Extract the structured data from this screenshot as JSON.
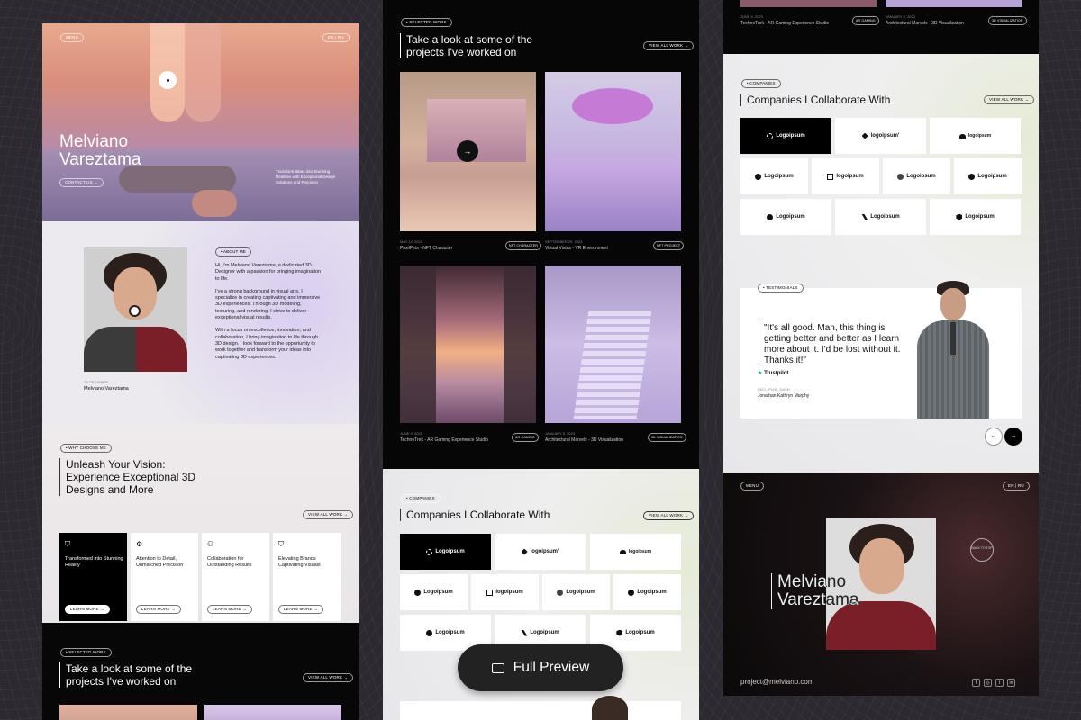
{
  "col1": {
    "menu": "MENU",
    "lang": "EN | RU",
    "hero_name": "Melviano Vareztama",
    "hero_tag": "Transform Ideas into Stunning Realities with Exceptional Design Solutions and Precision",
    "contact": "CONTACT US →",
    "about_tag": "• ABOUT ME",
    "about_p1": "Hi, I'm Melviano Vareztama, a dedicated 3D Designer with a passion for bringing imagination to life.",
    "about_p2": "I've a strong background in visual arts, I specialize in creating captivating and immersive 3D experiences. Through 3D modeling, texturing, and rendering, I strive to deliver exceptional visual results.",
    "about_p3": "With a focus on excellence, innovation, and collaboration, I bring imagination to life through 3D design. I look forward to the opportunity to work together and transform your ideas into captivating 3D experiences.",
    "role": "3D DESIGNER",
    "person": "Melviano Vareztama",
    "why_tag": "• WHY CHOOSE ME",
    "why_head": "Unleash Your Vision: Experience Exceptional 3D Designs and More",
    "view_all": "VIEW ALL WORK →",
    "services": [
      {
        "icon": "⛉",
        "text": "Transformed into Stunning Reality",
        "btn": "LEARN MORE →"
      },
      {
        "icon": "⚙",
        "text": "Attention to Detail, Unmatched Precision",
        "btn": "LEARN MORE →"
      },
      {
        "icon": "⚇",
        "text": "Collaboration for Outstanding Results",
        "btn": "LEARN MORE →"
      },
      {
        "icon": "⛉",
        "text": "Elevating Brands Captivating Visuals",
        "btn": "LEARN MORE →"
      }
    ],
    "sel_tag": "• SELECTED WORK",
    "sel_head": "Take a look at some of the projects I've worked on",
    "view_all2": "VIEW ALL WORK →"
  },
  "col2": {
    "sel_tag": "• SELECTED WORK",
    "head": "Take a look at some of the projects I've worked on",
    "view_all": "VIEW ALL WORK →",
    "projects": [
      {
        "date": "MAY 14, 2023",
        "title": "PixelPets - NFT Character",
        "tag": "NFT CHARACTER"
      },
      {
        "date": "SEPTEMBER 29, 2023",
        "title": "Virtual Vistas - VR Environment",
        "tag": "NFT PROJECT"
      },
      {
        "date": "JUNE 9, 2023",
        "title": "TechnoTrek - AR Gaming Experience Studio",
        "tag": "AR GAMING"
      },
      {
        "date": "JANUARY 5, 2023",
        "title": "Architectural Marvels - 3D Visualization",
        "tag": "3D VISUALIZATION"
      }
    ],
    "comp_tag": "• COMPANIES",
    "comp_head": "Companies I Collaborate With",
    "view_all2": "VIEW ALL WORK →",
    "preview": "Full Preview"
  },
  "col3": {
    "p1": {
      "date": "JUNE 9, 2023",
      "title": "TechnoTrek - AR Gaming Experience Studio",
      "tag": "AR GAMING"
    },
    "p2": {
      "date": "JANUARY 5, 2023",
      "title": "Architectural Marvels - 3D Visualization",
      "tag": "3D VISUALIZATION"
    },
    "comp_tag": "• COMPANIES",
    "comp_head": "Companies I Collaborate With",
    "view_all": "VIEW ALL WORK →",
    "test_tag": "• TESTIMONIALS",
    "quote": "\"It's all good. Man, this thing is getting better and better as I learn more about it. I'd be lost without it. Thanks it!\"",
    "trustpilot": "Trustpilot",
    "role": "CEO - PIXEL DASH",
    "author": "Jonathan Kathryn Murphy",
    "prev": "←",
    "next": "→",
    "menu": "MENU",
    "lang": "EN | RU",
    "name": "Melviano Vareztama",
    "badge": "BACK TO TOP",
    "email": "project@melviano.com",
    "socials": [
      "f",
      "◎",
      "t",
      "in"
    ]
  },
  "logos": [
    {
      "name": "Logoipsum",
      "style": "dark"
    },
    {
      "name": "logoipsum'",
      "style": "light"
    },
    {
      "name": "logoipsum",
      "style": "light"
    },
    {
      "name": "Logoipsum",
      "style": "light"
    },
    {
      "name": "logoipsum",
      "style": "light"
    },
    {
      "name": "Logoipsum",
      "style": "light"
    },
    {
      "name": "Logoipsum",
      "style": "light"
    },
    {
      "name": "Logoipsum",
      "style": "light"
    },
    {
      "name": "Logoipsum",
      "style": "light"
    },
    {
      "name": "Logoipsum",
      "style": "light"
    }
  ]
}
